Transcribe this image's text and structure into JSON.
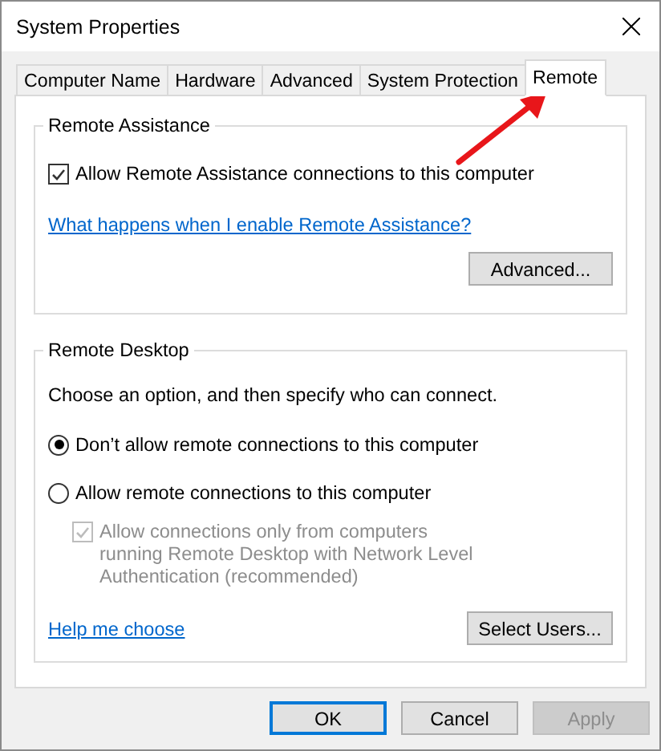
{
  "window": {
    "title": "System Properties"
  },
  "tabs": [
    {
      "label": "Computer Name",
      "selected": false
    },
    {
      "label": "Hardware",
      "selected": false
    },
    {
      "label": "Advanced",
      "selected": false
    },
    {
      "label": "System Protection",
      "selected": false
    },
    {
      "label": "Remote",
      "selected": true
    }
  ],
  "remote_assistance": {
    "title": "Remote Assistance",
    "checkbox": {
      "label": "Allow Remote Assistance connections to this computer",
      "checked": true
    },
    "link": "What happens when I enable Remote Assistance?",
    "button": "Advanced..."
  },
  "remote_desktop": {
    "title": "Remote Desktop",
    "instruction": "Choose an option, and then specify who can connect.",
    "options": [
      {
        "label": "Don’t allow remote connections to this computer",
        "selected": true
      },
      {
        "label": "Allow remote connections to this computer",
        "selected": false
      }
    ],
    "nla": {
      "label": "Allow connections only from computers running Remote Desktop with Network Level Authentication (recommended)",
      "checked": true,
      "disabled": true
    },
    "link": "Help me choose",
    "button": "Select Users..."
  },
  "buttons": [
    {
      "label": "OK",
      "kind": "default",
      "disabled": false
    },
    {
      "label": "Cancel",
      "kind": "normal",
      "disabled": false
    },
    {
      "label": "Apply",
      "kind": "normal",
      "disabled": true
    }
  ]
}
